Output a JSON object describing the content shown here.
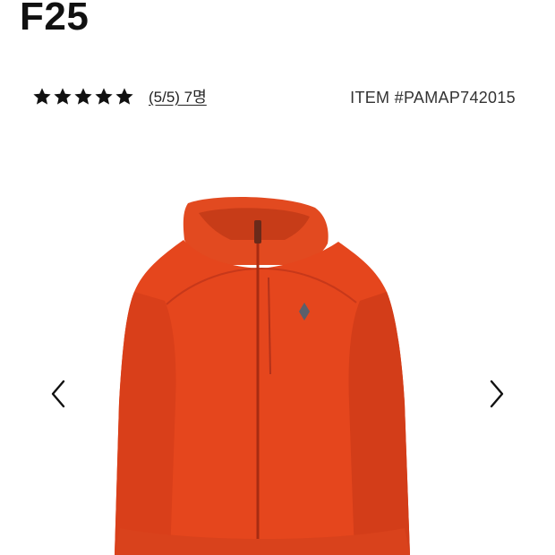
{
  "product": {
    "title": "F25",
    "rating": {
      "value": 5,
      "max": 5,
      "link_text": "(5/5) 7명"
    },
    "item_number": "ITEM #PAMAP742015"
  },
  "carousel": {
    "prev_icon": "chevron-left-icon",
    "next_icon": "chevron-right-icon",
    "image_subject": "orange hooded jacket"
  },
  "colors": {
    "jacket": "#e5461d",
    "jacket_shadow": "#c8391a",
    "text": "#111111",
    "logo": "#5b5f6b"
  }
}
